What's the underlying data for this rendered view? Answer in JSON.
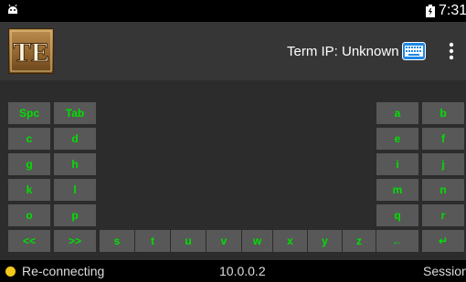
{
  "status_bar": {
    "time": "7:31"
  },
  "app_bar": {
    "logo_text": "TE",
    "term_ip": "Term IP: Unknown",
    "keyboard_icon": "keyboard-icon",
    "menu_icon": "more-vert-icon"
  },
  "keys": {
    "left_col1": [
      "Spc",
      "c",
      "g",
      "k",
      "o",
      "<<"
    ],
    "left_col2": [
      "Tab",
      "d",
      "h",
      "l",
      "p",
      ">>"
    ],
    "bottom_row": [
      "s",
      "t",
      "u",
      "v",
      "w",
      "x",
      "y",
      "z"
    ],
    "right_col1": [
      "a",
      "e",
      "i",
      "m",
      "q",
      "←"
    ],
    "right_col2": [
      "b",
      "f",
      "j",
      "n",
      "r",
      "↵"
    ]
  },
  "bottom_bar": {
    "status": "Re-connecting",
    "status_color": "#f4c81a",
    "ip": "10.0.0.2",
    "session": "Session"
  },
  "colors": {
    "key_bg": "#585858",
    "key_text": "#00e000",
    "appbar": "#363636"
  }
}
